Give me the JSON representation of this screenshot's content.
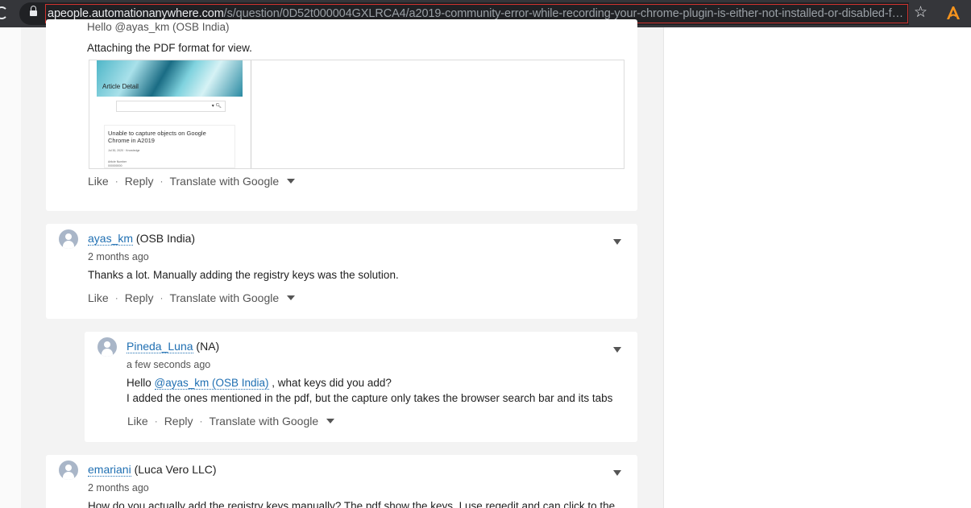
{
  "browser": {
    "url_host": "apeople.automationanywhere.com",
    "url_path": "/s/question/0D52t000004GXLRCA4/a2019-community-error-while-recording-your-chrome-plugin-is-either-not-installed-or-disabled-fo...",
    "icons": [
      "reload-icon",
      "lock-icon",
      "star-icon",
      "extension-icon"
    ]
  },
  "posts": [
    {
      "partial_top_text": "Hello @ayas_km (OSB India)",
      "body": "Attaching the PDF format for view.",
      "attachment": {
        "banner_title": "Article Detail",
        "heading": "Unable to capture objects on Google Chrome in A2019",
        "date_line": "Jul 30, 2020 · Knowledge",
        "article_number_label": "Article Number",
        "article_number": "000000000"
      },
      "actions": {
        "like": "Like",
        "reply": "Reply",
        "translate": "Translate with Google"
      }
    },
    {
      "author": "ayas_km",
      "org": "(OSB India)",
      "time": "2 months ago",
      "body": "Thanks a lot. Manually adding the registry keys was the solution.",
      "actions": {
        "like": "Like",
        "reply": "Reply",
        "translate": "Translate with Google"
      }
    },
    {
      "author": "Pineda_Luna",
      "org": "(NA)",
      "time": "a few seconds ago",
      "body_prefix": "Hello ",
      "mention": "@ayas_km",
      "mention_org": "(OSB India)",
      "body_suffix": " , what keys did you add?",
      "body_line2": "I added the ones mentioned in the pdf, but the capture only takes the browser search bar and its tabs",
      "actions": {
        "like": "Like",
        "reply": "Reply",
        "translate": "Translate with Google"
      }
    },
    {
      "author": "emariani",
      "org": "(Luca Vero LLC)",
      "time": "2 months ago",
      "body": "How do you actually add the registry keys manually? The pdf show the keys. I use regedit and can click to the"
    }
  ],
  "separator": "·"
}
